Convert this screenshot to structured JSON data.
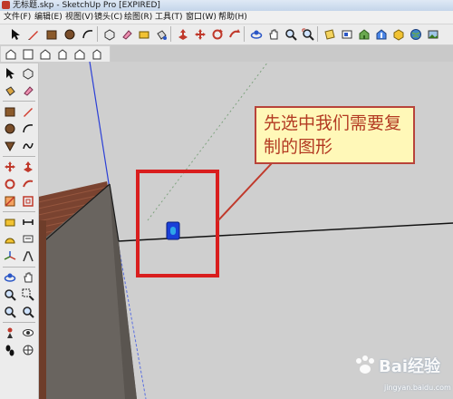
{
  "window": {
    "title": "无标题.skp - SketchUp Pro [EXPIRED]"
  },
  "menu": [
    "文件(F)",
    "编辑(E)",
    "视图(V)",
    "镜头(C)",
    "绘图(R)",
    "工具(T)",
    "窗口(W)",
    "帮助(H)"
  ],
  "toolbar_icons": [
    "select-icon",
    "pencil-icon",
    "rectangle-icon",
    "circle-icon",
    "arc-icon",
    "eraser-icon",
    "paint-bucket-icon",
    "push-pull-icon",
    "move-icon",
    "rotate-icon",
    "follow-me-icon",
    "orbit-icon",
    "pan-icon",
    "zoom-icon",
    "zoom-extents-icon",
    "section-icon",
    "warehouse-icon",
    "component-icon",
    "layer-icon",
    "globe-icon"
  ],
  "views_toolbar": [
    "iso-view-icon",
    "top-view-icon",
    "front-view-icon",
    "right-view-icon",
    "back-view-icon",
    "left-view-icon"
  ],
  "callout": {
    "text": "先选中我们需要复制的图形"
  },
  "watermark": {
    "logo": "Bai经验",
    "url": "jingyan.baidu.com"
  },
  "colors": {
    "highlight_box": "#d91e1e",
    "callout_bg": "#fff8b8",
    "callout_text": "#b33a22",
    "selected": "#1a3fd8"
  }
}
